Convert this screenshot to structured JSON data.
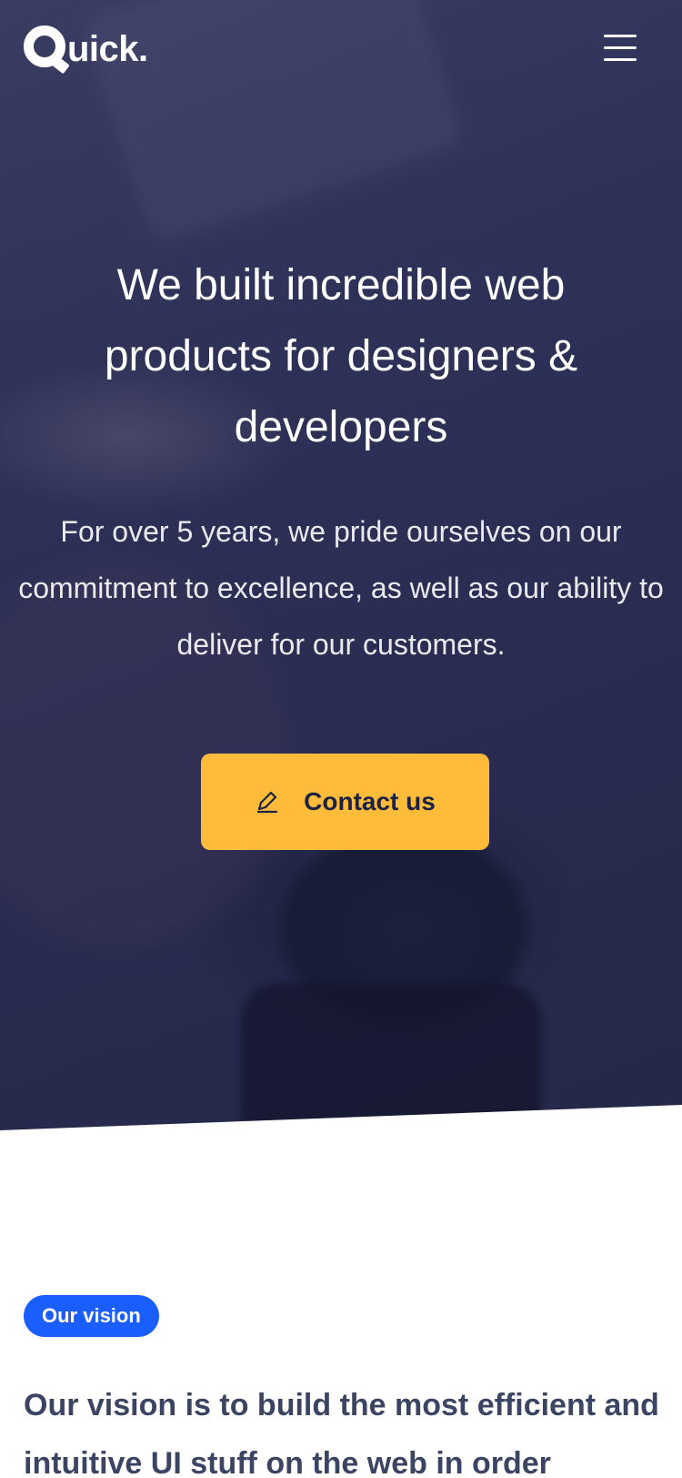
{
  "header": {
    "logo_text": "uick.",
    "logo_letter": "Q",
    "menu_icon": "hamburger-menu-icon"
  },
  "hero": {
    "title": "We built incredible web products for designers & developers",
    "subtitle": "For over 5 years, we pride ourselves on our commitment to excellence, as well as our ability to deliver for our customers.",
    "cta_label": "Contact us",
    "cta_icon": "pen-icon",
    "cta_color": "#ffbc3b"
  },
  "vision": {
    "badge": "Our vision",
    "badge_color": "#1a5eff",
    "text": "Our vision is to build the most efficient and intuitive UI stuff on the web in order"
  }
}
